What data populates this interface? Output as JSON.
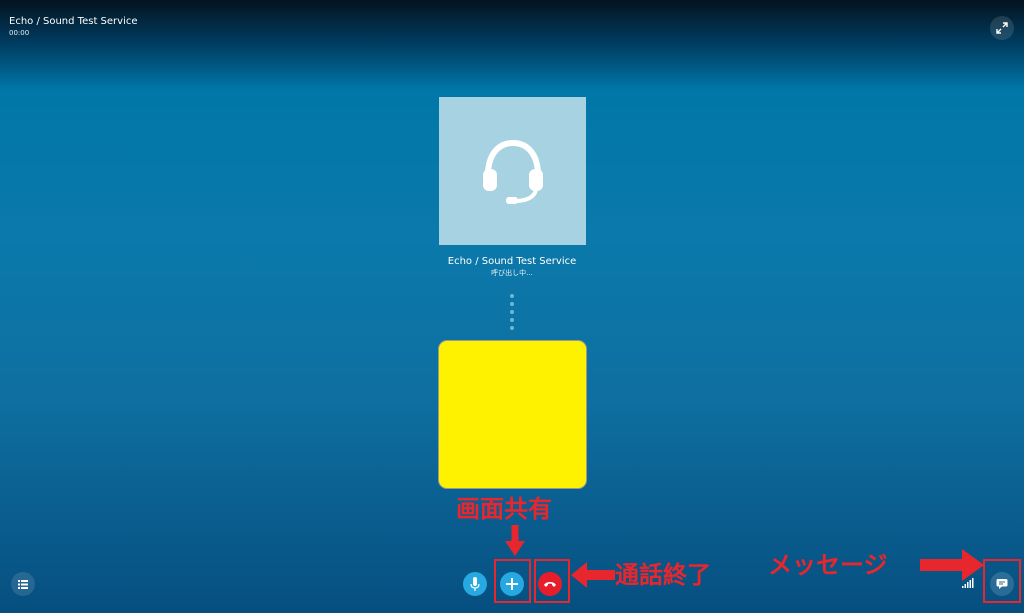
{
  "header": {
    "title": "Echo / Sound Test Service",
    "timer": "00:00"
  },
  "remote": {
    "name": "Echo / Sound Test Service",
    "status": "呼び出し中..."
  },
  "controls": {
    "icons": {
      "expand": "expand-icon",
      "list": "list-icon",
      "mic": "microphone-icon",
      "add": "plus-icon",
      "hangup": "phone-hangup-icon",
      "chat": "chat-bubble-icon",
      "signal": "signal-strength-icon",
      "avatar": "headset-icon"
    }
  },
  "annotations": {
    "share_label": "画面共有",
    "end_label": "通話終了",
    "message_label": "メッセージ"
  },
  "colors": {
    "annotation": "#e8262d",
    "accent_button": "#25a9e0",
    "hangup": "#e81d2c",
    "self_video": "#fff200",
    "avatar_bg": "#a7d2e2"
  }
}
